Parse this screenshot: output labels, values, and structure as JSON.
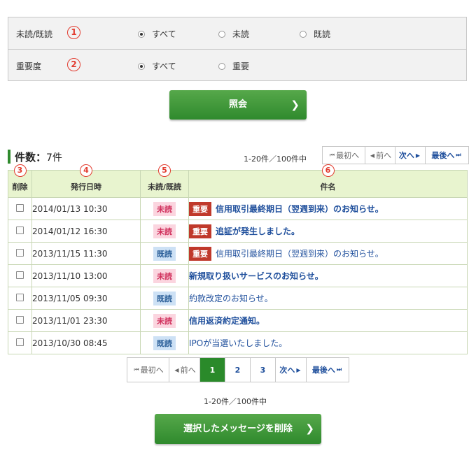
{
  "filters": {
    "read_label": "未読/既読",
    "read_num": "1",
    "read_options": [
      "すべて",
      "未読",
      "既読"
    ],
    "importance_label": "重要度",
    "importance_num": "2",
    "importance_options": [
      "すべて",
      "重要"
    ]
  },
  "query_button": "照会",
  "count": {
    "label": "件数：",
    "value": "7件"
  },
  "range_text": "1-20件／100件中",
  "top_pager": {
    "first": "最初へ",
    "prev": "前へ",
    "next": "次へ",
    "last": "最後へ"
  },
  "table": {
    "headers": [
      "削除",
      "発行日時",
      "未読/既読",
      "件名"
    ],
    "header_nums": [
      "3",
      "4",
      "5",
      "6"
    ],
    "important_label": "重要",
    "rows": [
      {
        "date": "2014/01/13 10:30",
        "status": "未読",
        "important": true,
        "subject": "信用取引最終期日（翌週到来）のお知らせ。",
        "bold": true
      },
      {
        "date": "2014/01/12 16:30",
        "status": "未読",
        "important": true,
        "subject": "追証が発生しました。",
        "bold": true
      },
      {
        "date": "2013/11/15 11:30",
        "status": "既読",
        "important": true,
        "subject": "信用取引最終期日（翌週到来）のお知らせ。",
        "bold": false
      },
      {
        "date": "2013/11/10 13:00",
        "status": "未読",
        "important": false,
        "subject": "新規取り扱いサービスのお知らせ。",
        "bold": true
      },
      {
        "date": "2013/11/05 09:30",
        "status": "既読",
        "important": false,
        "subject": "約款改定のお知らせ。",
        "bold": false
      },
      {
        "date": "2013/11/01 23:30",
        "status": "未読",
        "important": false,
        "subject": "信用返済約定通知。",
        "bold": true
      },
      {
        "date": "2013/10/30 08:45",
        "status": "既読",
        "important": false,
        "subject": "IPOが当選いたしました。",
        "bold": false
      }
    ]
  },
  "bottom_pager": {
    "first": "最初へ",
    "prev": "前へ",
    "pages": [
      "1",
      "2",
      "3"
    ],
    "next": "次へ",
    "last": "最後へ",
    "current": "1"
  },
  "delete_button": "選択したメッセージを削除",
  "colors": {
    "accent_green": "#2f8a2d",
    "link_blue": "#1f4f9c",
    "important_red": "#c0392b"
  }
}
